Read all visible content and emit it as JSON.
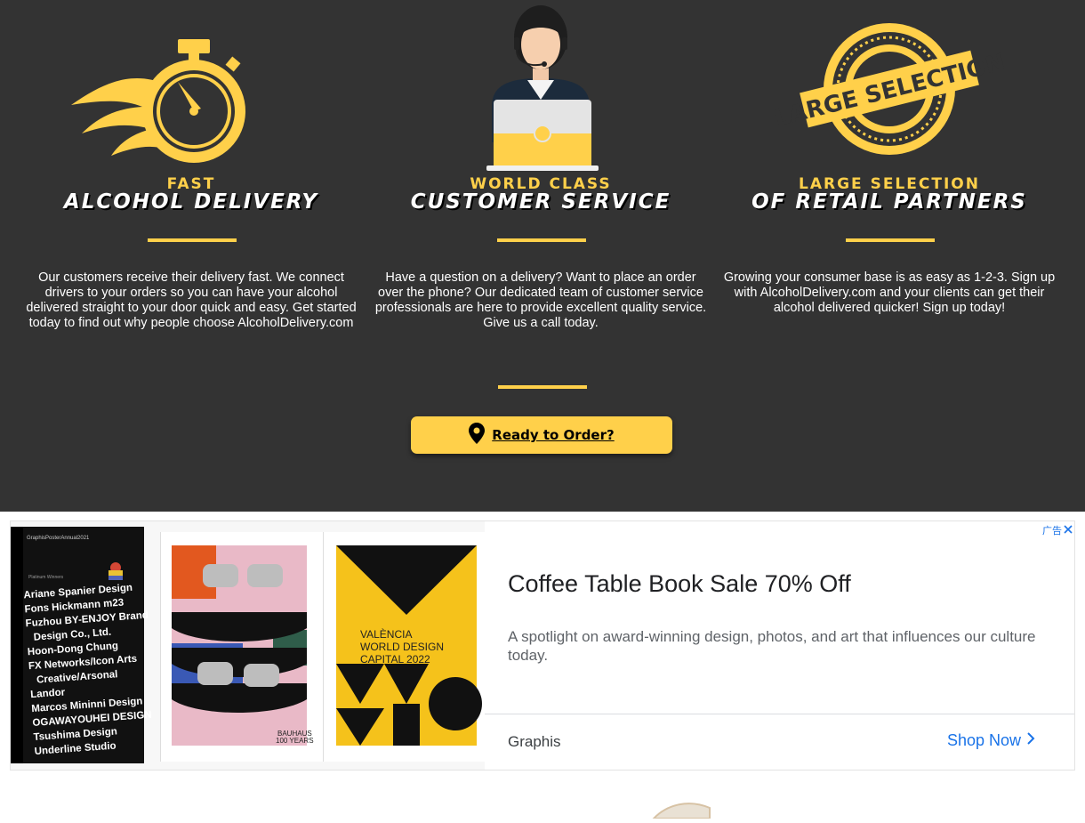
{
  "features": [
    {
      "kicker": "FAST",
      "heading": "ALCOHOL DELIVERY",
      "icon": "stopwatch-icon",
      "description": "Our customers receive their delivery fast. We connect drivers to your orders so you can have your alcohol delivered straight to your door quick and easy. Get started today to find out why people choose AlcoholDelivery.com"
    },
    {
      "kicker": "WORLD CLASS",
      "heading": "CUSTOMER SERVICE",
      "icon": "support-agent-icon",
      "description": "Have a question on a delivery? Want to place an order over the phone? Our dedicated team of customer service professionals are here to provide excellent quality service. Give us a call today."
    },
    {
      "kicker": "LARGE SELECTION",
      "heading": "OF RETAIL PARTNERS",
      "icon": "large-selection-stamp-icon",
      "stamp_text": "LARGE SELECTION",
      "description": "Growing your consumer base is as easy as 1-2-3. Sign up with AlcoholDelivery.com and your clients can get their alcohol delivered quicker! Sign up today!"
    }
  ],
  "cta": {
    "label": "Ready to Order?",
    "icon": "map-pin-icon"
  },
  "ad": {
    "adchoices_label": "广告",
    "close_icon": "close-icon",
    "title": "Coffee Table Book Sale 70% Off",
    "description": "A spotlight on award-winning design, photos, and art that influences our culture today.",
    "advertiser": "Graphis",
    "cta_label": "Shop Now",
    "book": {
      "spine": "GraphisPosterAnnual2021",
      "header": "Platinum Winners",
      "names": [
        "Ariane Spanier Design",
        "Fons Hickmann m23",
        "Fuzhou BY-ENJOY Brand",
        "Design Co., Ltd.",
        "Hoon-Dong Chung",
        "FX Networks/Icon Arts",
        "Creative/Arsonal",
        "Landor",
        "Marcos Mininni Design",
        "OGAWAYOUHEI DESIGN",
        "Tsushima Design",
        "Underline Studio"
      ]
    },
    "poster_left_caption": "BAUHAUS\n100 YEARS",
    "poster_right_lines": [
      "VALÈNCIA",
      "WORLD DESIGN",
      "CAPITAL 2022"
    ]
  },
  "colors": {
    "accent": "#ffd04a",
    "hero_bg": "#333333",
    "link": "#1a73e8"
  }
}
